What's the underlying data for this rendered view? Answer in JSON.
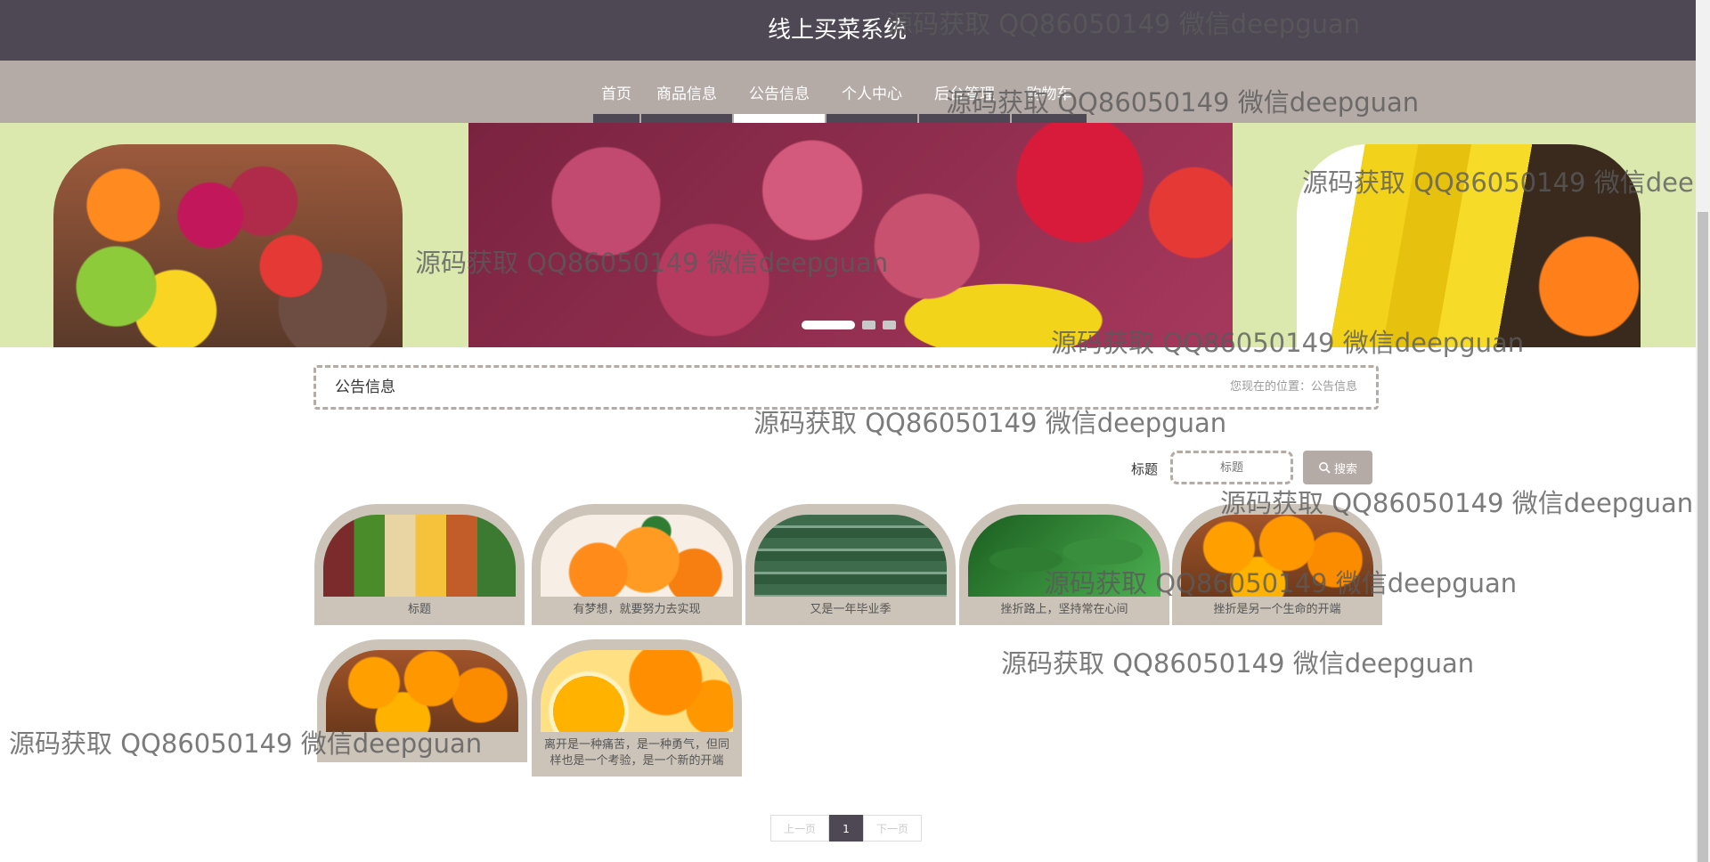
{
  "site": {
    "title": "线上买菜系统"
  },
  "nav": {
    "items": [
      {
        "label": "首页",
        "active": false
      },
      {
        "label": "商品信息",
        "active": false
      },
      {
        "label": "公告信息",
        "active": true
      },
      {
        "label": "个人中心",
        "active": false
      },
      {
        "label": "后台管理",
        "active": false
      },
      {
        "label": "购物车",
        "active": false
      }
    ]
  },
  "banner": {
    "dots": 3,
    "active_dot": 0
  },
  "breadcrumb": {
    "title": "公告信息",
    "location": "您现在的位置：公告信息"
  },
  "search": {
    "label": "标题",
    "placeholder": "标题",
    "button": "搜索"
  },
  "notices": [
    {
      "caption": "标题",
      "image": "vegetables-collage"
    },
    {
      "caption": "有梦想，就要努力去实现",
      "image": "tangerines"
    },
    {
      "caption": "又是一年毕业季",
      "image": "cucumbers"
    },
    {
      "caption": "挫折路上，坚持常在心间",
      "image": "spinach"
    },
    {
      "caption": "挫折是另一个生命的开端",
      "image": "oranges"
    },
    {
      "caption": "",
      "image": "oranges"
    },
    {
      "caption": "离开是一种痛苦，是一种勇气，但同样也是一个考验，是一个新的开端",
      "image": "sliced-orange"
    }
  ],
  "pagination": {
    "prev": "上一页",
    "current": "1",
    "next": "下一页"
  },
  "watermark": "源码获取 QQ86050149 微信deepguan",
  "colors": {
    "header": "#4e4754",
    "navbar": "#b5aba6",
    "card": "#ccc4b9",
    "banner_bg": "#dbe9ae"
  }
}
